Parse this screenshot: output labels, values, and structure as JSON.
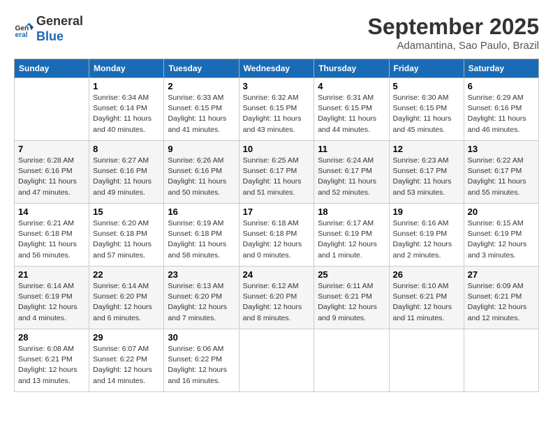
{
  "header": {
    "logo_line1": "General",
    "logo_line2": "Blue",
    "month": "September 2025",
    "location": "Adamantina, Sao Paulo, Brazil"
  },
  "weekdays": [
    "Sunday",
    "Monday",
    "Tuesday",
    "Wednesday",
    "Thursday",
    "Friday",
    "Saturday"
  ],
  "weeks": [
    [
      {
        "day": "",
        "info": ""
      },
      {
        "day": "1",
        "info": "Sunrise: 6:34 AM\nSunset: 6:14 PM\nDaylight: 11 hours\nand 40 minutes."
      },
      {
        "day": "2",
        "info": "Sunrise: 6:33 AM\nSunset: 6:15 PM\nDaylight: 11 hours\nand 41 minutes."
      },
      {
        "day": "3",
        "info": "Sunrise: 6:32 AM\nSunset: 6:15 PM\nDaylight: 11 hours\nand 43 minutes."
      },
      {
        "day": "4",
        "info": "Sunrise: 6:31 AM\nSunset: 6:15 PM\nDaylight: 11 hours\nand 44 minutes."
      },
      {
        "day": "5",
        "info": "Sunrise: 6:30 AM\nSunset: 6:15 PM\nDaylight: 11 hours\nand 45 minutes."
      },
      {
        "day": "6",
        "info": "Sunrise: 6:29 AM\nSunset: 6:16 PM\nDaylight: 11 hours\nand 46 minutes."
      }
    ],
    [
      {
        "day": "7",
        "info": "Sunrise: 6:28 AM\nSunset: 6:16 PM\nDaylight: 11 hours\nand 47 minutes."
      },
      {
        "day": "8",
        "info": "Sunrise: 6:27 AM\nSunset: 6:16 PM\nDaylight: 11 hours\nand 49 minutes."
      },
      {
        "day": "9",
        "info": "Sunrise: 6:26 AM\nSunset: 6:16 PM\nDaylight: 11 hours\nand 50 minutes."
      },
      {
        "day": "10",
        "info": "Sunrise: 6:25 AM\nSunset: 6:17 PM\nDaylight: 11 hours\nand 51 minutes."
      },
      {
        "day": "11",
        "info": "Sunrise: 6:24 AM\nSunset: 6:17 PM\nDaylight: 11 hours\nand 52 minutes."
      },
      {
        "day": "12",
        "info": "Sunrise: 6:23 AM\nSunset: 6:17 PM\nDaylight: 11 hours\nand 53 minutes."
      },
      {
        "day": "13",
        "info": "Sunrise: 6:22 AM\nSunset: 6:17 PM\nDaylight: 11 hours\nand 55 minutes."
      }
    ],
    [
      {
        "day": "14",
        "info": "Sunrise: 6:21 AM\nSunset: 6:18 PM\nDaylight: 11 hours\nand 56 minutes."
      },
      {
        "day": "15",
        "info": "Sunrise: 6:20 AM\nSunset: 6:18 PM\nDaylight: 11 hours\nand 57 minutes."
      },
      {
        "day": "16",
        "info": "Sunrise: 6:19 AM\nSunset: 6:18 PM\nDaylight: 11 hours\nand 58 minutes."
      },
      {
        "day": "17",
        "info": "Sunrise: 6:18 AM\nSunset: 6:18 PM\nDaylight: 12 hours\nand 0 minutes."
      },
      {
        "day": "18",
        "info": "Sunrise: 6:17 AM\nSunset: 6:19 PM\nDaylight: 12 hours\nand 1 minute."
      },
      {
        "day": "19",
        "info": "Sunrise: 6:16 AM\nSunset: 6:19 PM\nDaylight: 12 hours\nand 2 minutes."
      },
      {
        "day": "20",
        "info": "Sunrise: 6:15 AM\nSunset: 6:19 PM\nDaylight: 12 hours\nand 3 minutes."
      }
    ],
    [
      {
        "day": "21",
        "info": "Sunrise: 6:14 AM\nSunset: 6:19 PM\nDaylight: 12 hours\nand 4 minutes."
      },
      {
        "day": "22",
        "info": "Sunrise: 6:14 AM\nSunset: 6:20 PM\nDaylight: 12 hours\nand 6 minutes."
      },
      {
        "day": "23",
        "info": "Sunrise: 6:13 AM\nSunset: 6:20 PM\nDaylight: 12 hours\nand 7 minutes."
      },
      {
        "day": "24",
        "info": "Sunrise: 6:12 AM\nSunset: 6:20 PM\nDaylight: 12 hours\nand 8 minutes."
      },
      {
        "day": "25",
        "info": "Sunrise: 6:11 AM\nSunset: 6:21 PM\nDaylight: 12 hours\nand 9 minutes."
      },
      {
        "day": "26",
        "info": "Sunrise: 6:10 AM\nSunset: 6:21 PM\nDaylight: 12 hours\nand 11 minutes."
      },
      {
        "day": "27",
        "info": "Sunrise: 6:09 AM\nSunset: 6:21 PM\nDaylight: 12 hours\nand 12 minutes."
      }
    ],
    [
      {
        "day": "28",
        "info": "Sunrise: 6:08 AM\nSunset: 6:21 PM\nDaylight: 12 hours\nand 13 minutes."
      },
      {
        "day": "29",
        "info": "Sunrise: 6:07 AM\nSunset: 6:22 PM\nDaylight: 12 hours\nand 14 minutes."
      },
      {
        "day": "30",
        "info": "Sunrise: 6:06 AM\nSunset: 6:22 PM\nDaylight: 12 hours\nand 16 minutes."
      },
      {
        "day": "",
        "info": ""
      },
      {
        "day": "",
        "info": ""
      },
      {
        "day": "",
        "info": ""
      },
      {
        "day": "",
        "info": ""
      }
    ]
  ]
}
